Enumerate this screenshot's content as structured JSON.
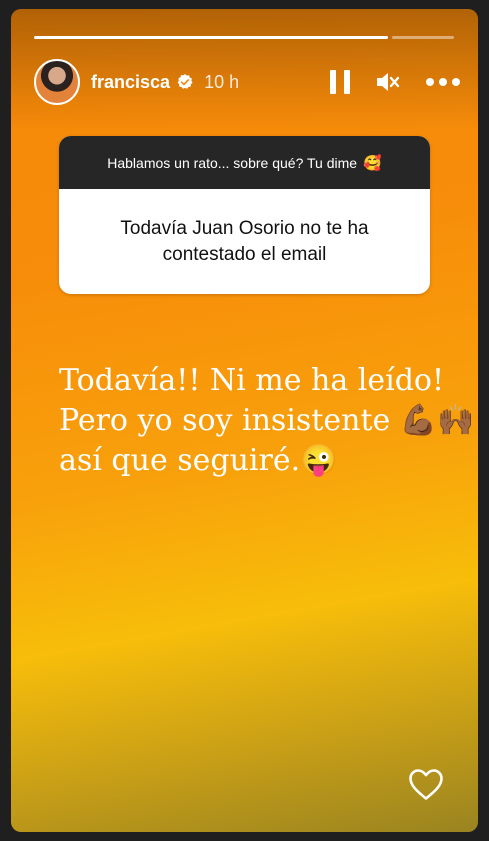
{
  "story": {
    "progress_segments": 2,
    "current_segment": 1,
    "user": {
      "avatar_icon": "avatar",
      "username": "francisca",
      "verified_icon": "verified-badge-icon",
      "time_ago": "10 h"
    },
    "controls": {
      "pause_icon": "pause-icon",
      "mute_icon": "speaker-muted-icon",
      "more_icon": "more-options-icon"
    },
    "question_sticker": {
      "prompt": "Hablamos un rato... sobre qué? Tu dime",
      "prompt_emoji": "🥰",
      "question": "Todavía Juan Osorio no te ha contestado el email"
    },
    "answer_text": {
      "line1": "Todavía!! Ni me ha leído!",
      "line2": "Pero yo soy insistente 💪🏾🙌🏾",
      "line3": "así que seguiré.😜"
    },
    "like_icon": "heart-icon"
  }
}
